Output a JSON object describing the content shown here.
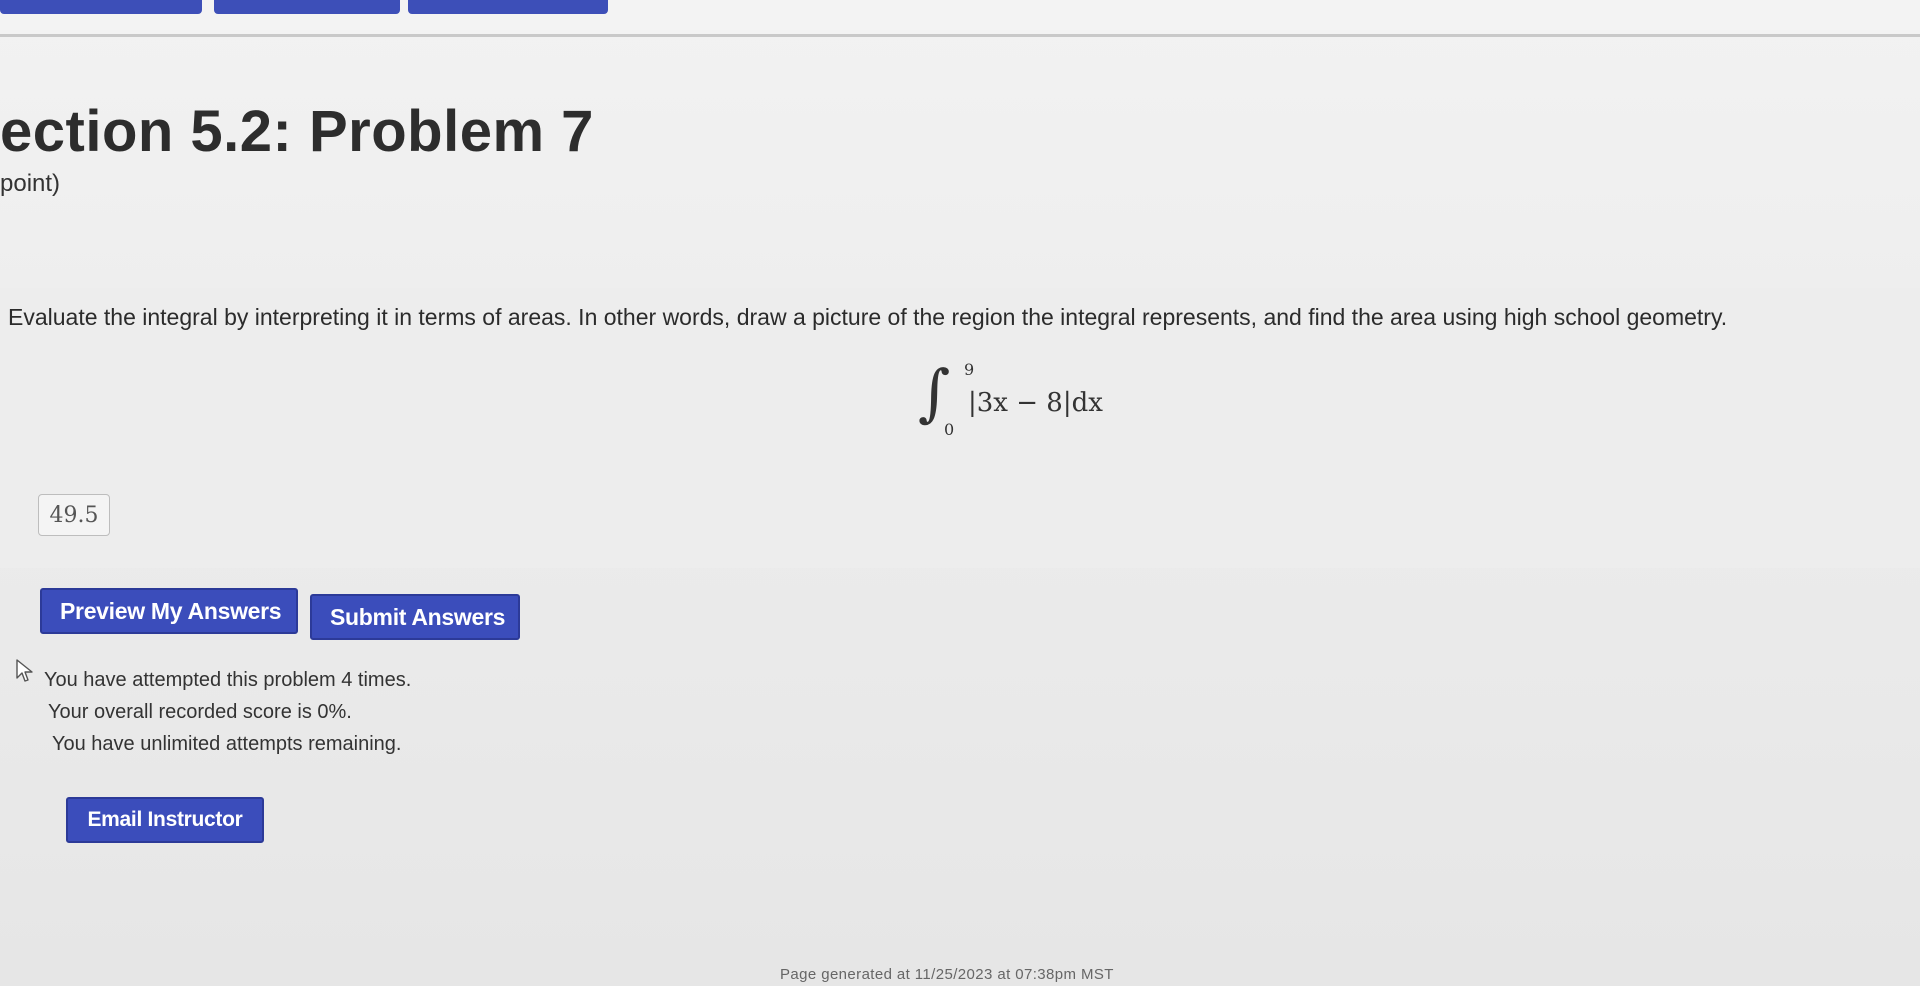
{
  "nav": {
    "buttons": [
      "",
      "",
      ""
    ],
    "accent_color": "#3d4fb8"
  },
  "header": {
    "title": "ection 5.2: Problem 7",
    "points": "point)"
  },
  "problem": {
    "statement": "Evaluate the integral by interpreting it in terms of areas. In other words, draw a picture of the region the integral represents, and find the area using high school geometry.",
    "integral": {
      "sign": "∫",
      "upper": "9",
      "lower": "0",
      "integrand": "|3x − 8|dx"
    }
  },
  "answer": {
    "value": "49.5"
  },
  "buttons": {
    "preview": "Preview My Answers",
    "submit": "Submit Answers",
    "email": "Email Instructor",
    "color": "#3b4dbb"
  },
  "status": {
    "icon": "pointer-cursor-icon",
    "line1": "You have attempted this problem 4 times.",
    "line2": "Your overall recorded score is 0%.",
    "line3": "You have unlimited attempts remaining."
  },
  "footer": {
    "generated": "Page generated at 11/25/2023 at 07:38pm MST"
  }
}
